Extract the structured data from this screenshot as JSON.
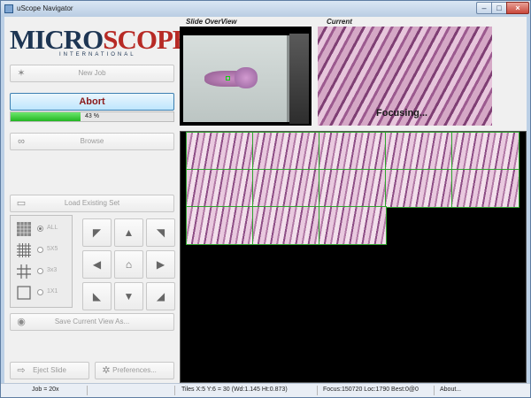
{
  "window": {
    "title": "uScope Navigator"
  },
  "logo": {
    "main_a": "MICRO",
    "main_b": "SCOPES",
    "sub": "INTERNATIONAL"
  },
  "buttons": {
    "new_job": "New Job",
    "abort": "Abort",
    "browse": "Browse",
    "load_existing": "Load Existing Set",
    "save_view": "Save Current View As...",
    "eject": "Eject Slide",
    "preferences": "Preferences..."
  },
  "progress": {
    "value": 0.43,
    "label": "43 %"
  },
  "grid_options": [
    {
      "label": "ALL",
      "selected": true
    },
    {
      "label": "5X5",
      "selected": false
    },
    {
      "label": "3x3",
      "selected": false
    },
    {
      "label": "1X1",
      "selected": false
    }
  ],
  "panels": {
    "overview_label": "Slide OverView",
    "current_label": "Current",
    "focus_status": "Focusing..."
  },
  "mosaic": {
    "rows_filled": [
      5,
      5,
      3
    ],
    "columns": 5
  },
  "status": {
    "job": "Job = 20x",
    "tiles": "Tiles X:5 Y:6 = 30 (Wd:1.145 Ht:0.873)",
    "focus": "Focus:150720 Loc:1790 Best:0@0",
    "about": "About..."
  },
  "colors": {
    "accent": "#3c7fb1",
    "abort_text": "#8b1a1a",
    "progress_fill": "#22b522",
    "tile_grid": "#2ea52e"
  },
  "icons": {
    "new_job": "wand-icon",
    "browse": "binoculars-icon",
    "load": "folder-icon",
    "save": "disk-icon",
    "eject": "eject-icon",
    "preferences": "gear-icon"
  }
}
